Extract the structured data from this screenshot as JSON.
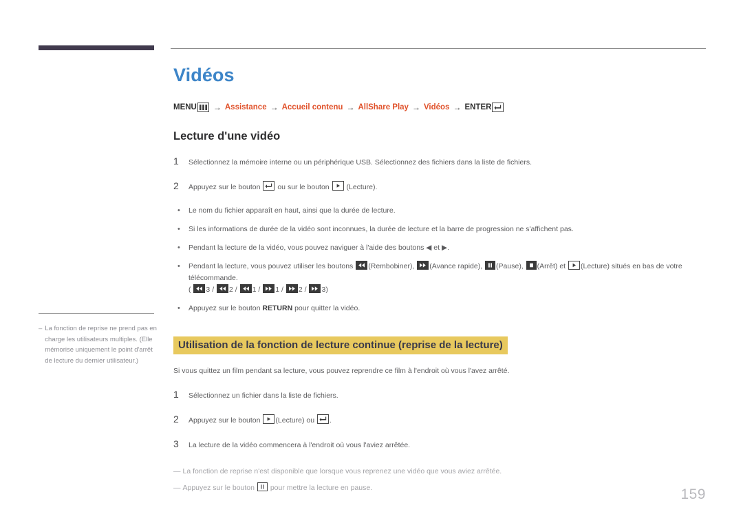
{
  "page": {
    "number": "159",
    "title": "Vidéos"
  },
  "breadcrumb": {
    "menu_label": "MENU",
    "menu_icon": "menu-bars-icon",
    "arrow": "→",
    "items": [
      {
        "label": "Assistance",
        "color": "#e0512a"
      },
      {
        "label": "Accueil contenu",
        "color": "#e0512a"
      },
      {
        "label": "AllShare Play",
        "color": "#e0512a"
      },
      {
        "label": "Vidéos",
        "color": "#e0512a"
      }
    ],
    "enter_label": "ENTER",
    "enter_icon": "enter-key-icon"
  },
  "section": {
    "heading": "Lecture d'une vidéo",
    "steps": [
      {
        "num": "1",
        "text": "Sélectionnez la mémoire interne ou un périphérique USB. Sélectionnez des fichiers dans la liste de fichiers."
      },
      {
        "num": "2",
        "text_before": "Appuyez sur le bouton",
        "icon1": "enter-key-icon",
        "text_mid": "ou sur le bouton",
        "icon2": "play-icon",
        "text_after": "(Lecture)."
      }
    ],
    "bullets": [
      {
        "text": "Le nom du fichier apparaît en haut, ainsi que la durée de lecture."
      },
      {
        "text": "Si les informations de durée de la vidéo sont inconnues, la durée de lecture et la barre de progression ne s'affichent pas."
      },
      {
        "text_before": "Pendant la lecture de la vidéo, vous pouvez naviguer à l'aide des boutons",
        "glyph1": "◀",
        "text_mid": "et",
        "glyph2": "▶",
        "text_after": "."
      },
      {
        "text_before": "Pendant la lecture, vous pouvez utiliser les boutons",
        "label_rewind": "(Rembobiner),",
        "label_ff": "(Avance rapide),",
        "label_pause": "(Pause),",
        "label_stop": "(Arrêt) et",
        "label_play": "(Lecture) situés en bas de votre télécommande.",
        "speed_line": {
          "open": "(",
          "items": [
            "3",
            "2",
            "1",
            "1",
            "2",
            "3"
          ],
          "separator": "/",
          "close": ")"
        }
      },
      {
        "text_before": "Appuyez sur le bouton",
        "bold": "RETURN",
        "text_after": "pour quitter la vidéo."
      }
    ]
  },
  "resume_section": {
    "highlight_heading": "Utilisation de la fonction de lecture continue (reprise de la lecture)",
    "highlight_color": "#e8c95e",
    "intro": "Si vous quittez un film pendant sa lecture, vous pouvez reprendre ce film à l'endroit où vous l'avez arrêté.",
    "steps": [
      {
        "num": "1",
        "text": "Sélectionnez un fichier dans la liste de fichiers."
      },
      {
        "num": "2",
        "text_before": "Appuyez sur le bouton",
        "icon1": "play-icon",
        "text_mid": "(Lecture) ou",
        "icon2": "enter-key-icon",
        "text_after": "."
      },
      {
        "num": "3",
        "text": "La lecture de la vidéo commencera à l'endroit où vous l'aviez arrêtée."
      }
    ],
    "footnotes": [
      {
        "dash": "―",
        "text": "La fonction de reprise n'est disponible que lorsque vous reprenez une vidéo que vous aviez arrêtée."
      },
      {
        "dash": "―",
        "text_before": "Appuyez sur le bouton",
        "icon": "pause-icon",
        "text_after": "pour mettre la lecture en pause."
      }
    ]
  },
  "side_note": {
    "dash": "–",
    "text": "La fonction de reprise ne prend pas en charge les utilisateurs multiples. (Elle mémorise uniquement le point d'arrêt de lecture du dernier utilisateur.)"
  }
}
